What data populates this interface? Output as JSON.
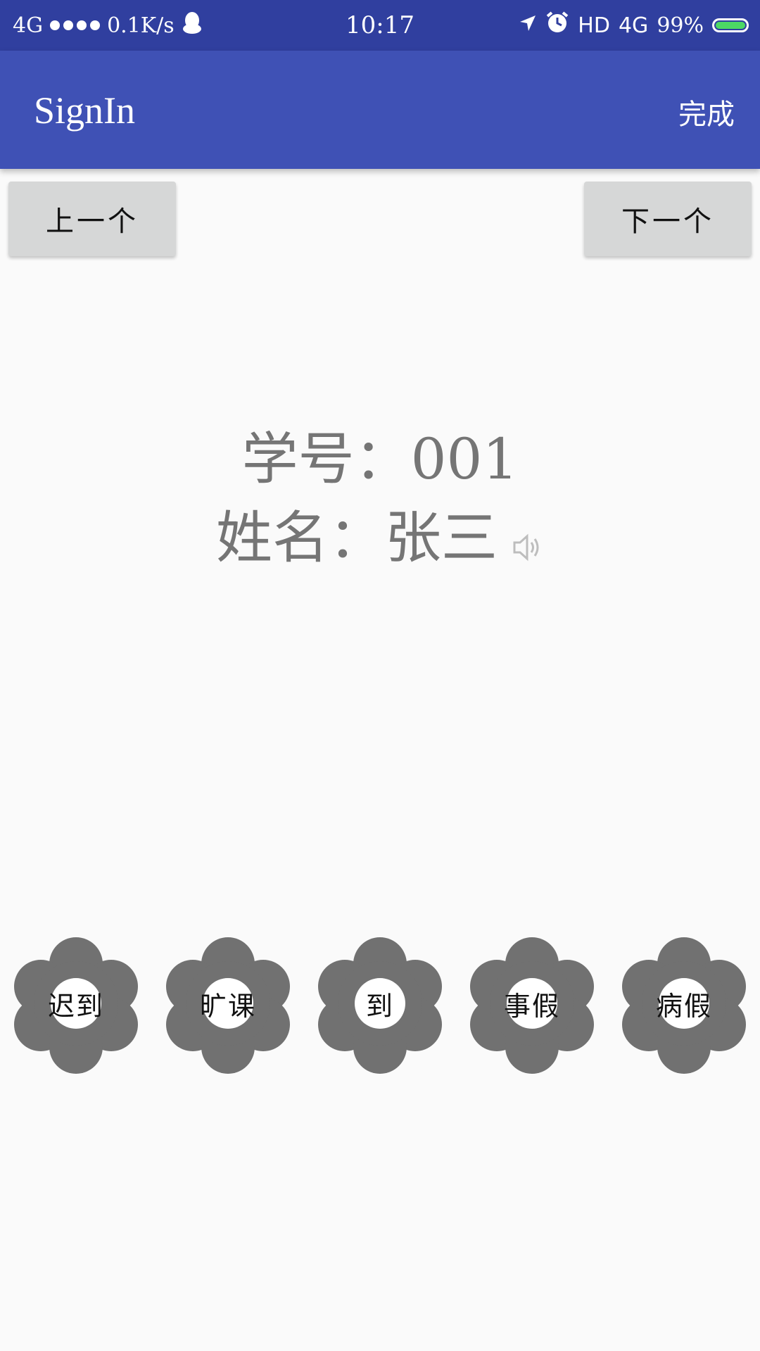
{
  "status_bar": {
    "network": "4G",
    "speed": "0.1K/s",
    "time": "10:17",
    "hd": "HD",
    "network_right": "4G",
    "battery": "99%",
    "battery_level": 0.99
  },
  "app_bar": {
    "title": "SignIn",
    "action": "完成"
  },
  "nav": {
    "prev_label": "上一个",
    "next_label": "下一个"
  },
  "student": {
    "id_label": "学号：",
    "id_value": "001",
    "name_label": "姓名：",
    "name_value": "张三"
  },
  "attendance_options": [
    {
      "label": "迟到"
    },
    {
      "label": "旷课"
    },
    {
      "label": "到"
    },
    {
      "label": "事假"
    },
    {
      "label": "病假"
    }
  ],
  "colors": {
    "status_bar": "#303f9f",
    "app_bar": "#3f51b5",
    "flower": "#717171",
    "button": "#d6d7d7",
    "info_text": "#757575"
  },
  "icons": {
    "speaker": "speaker-icon",
    "location": "location-arrow-icon",
    "alarm": "alarm-clock-icon",
    "qq": "qq-penguin-icon"
  }
}
